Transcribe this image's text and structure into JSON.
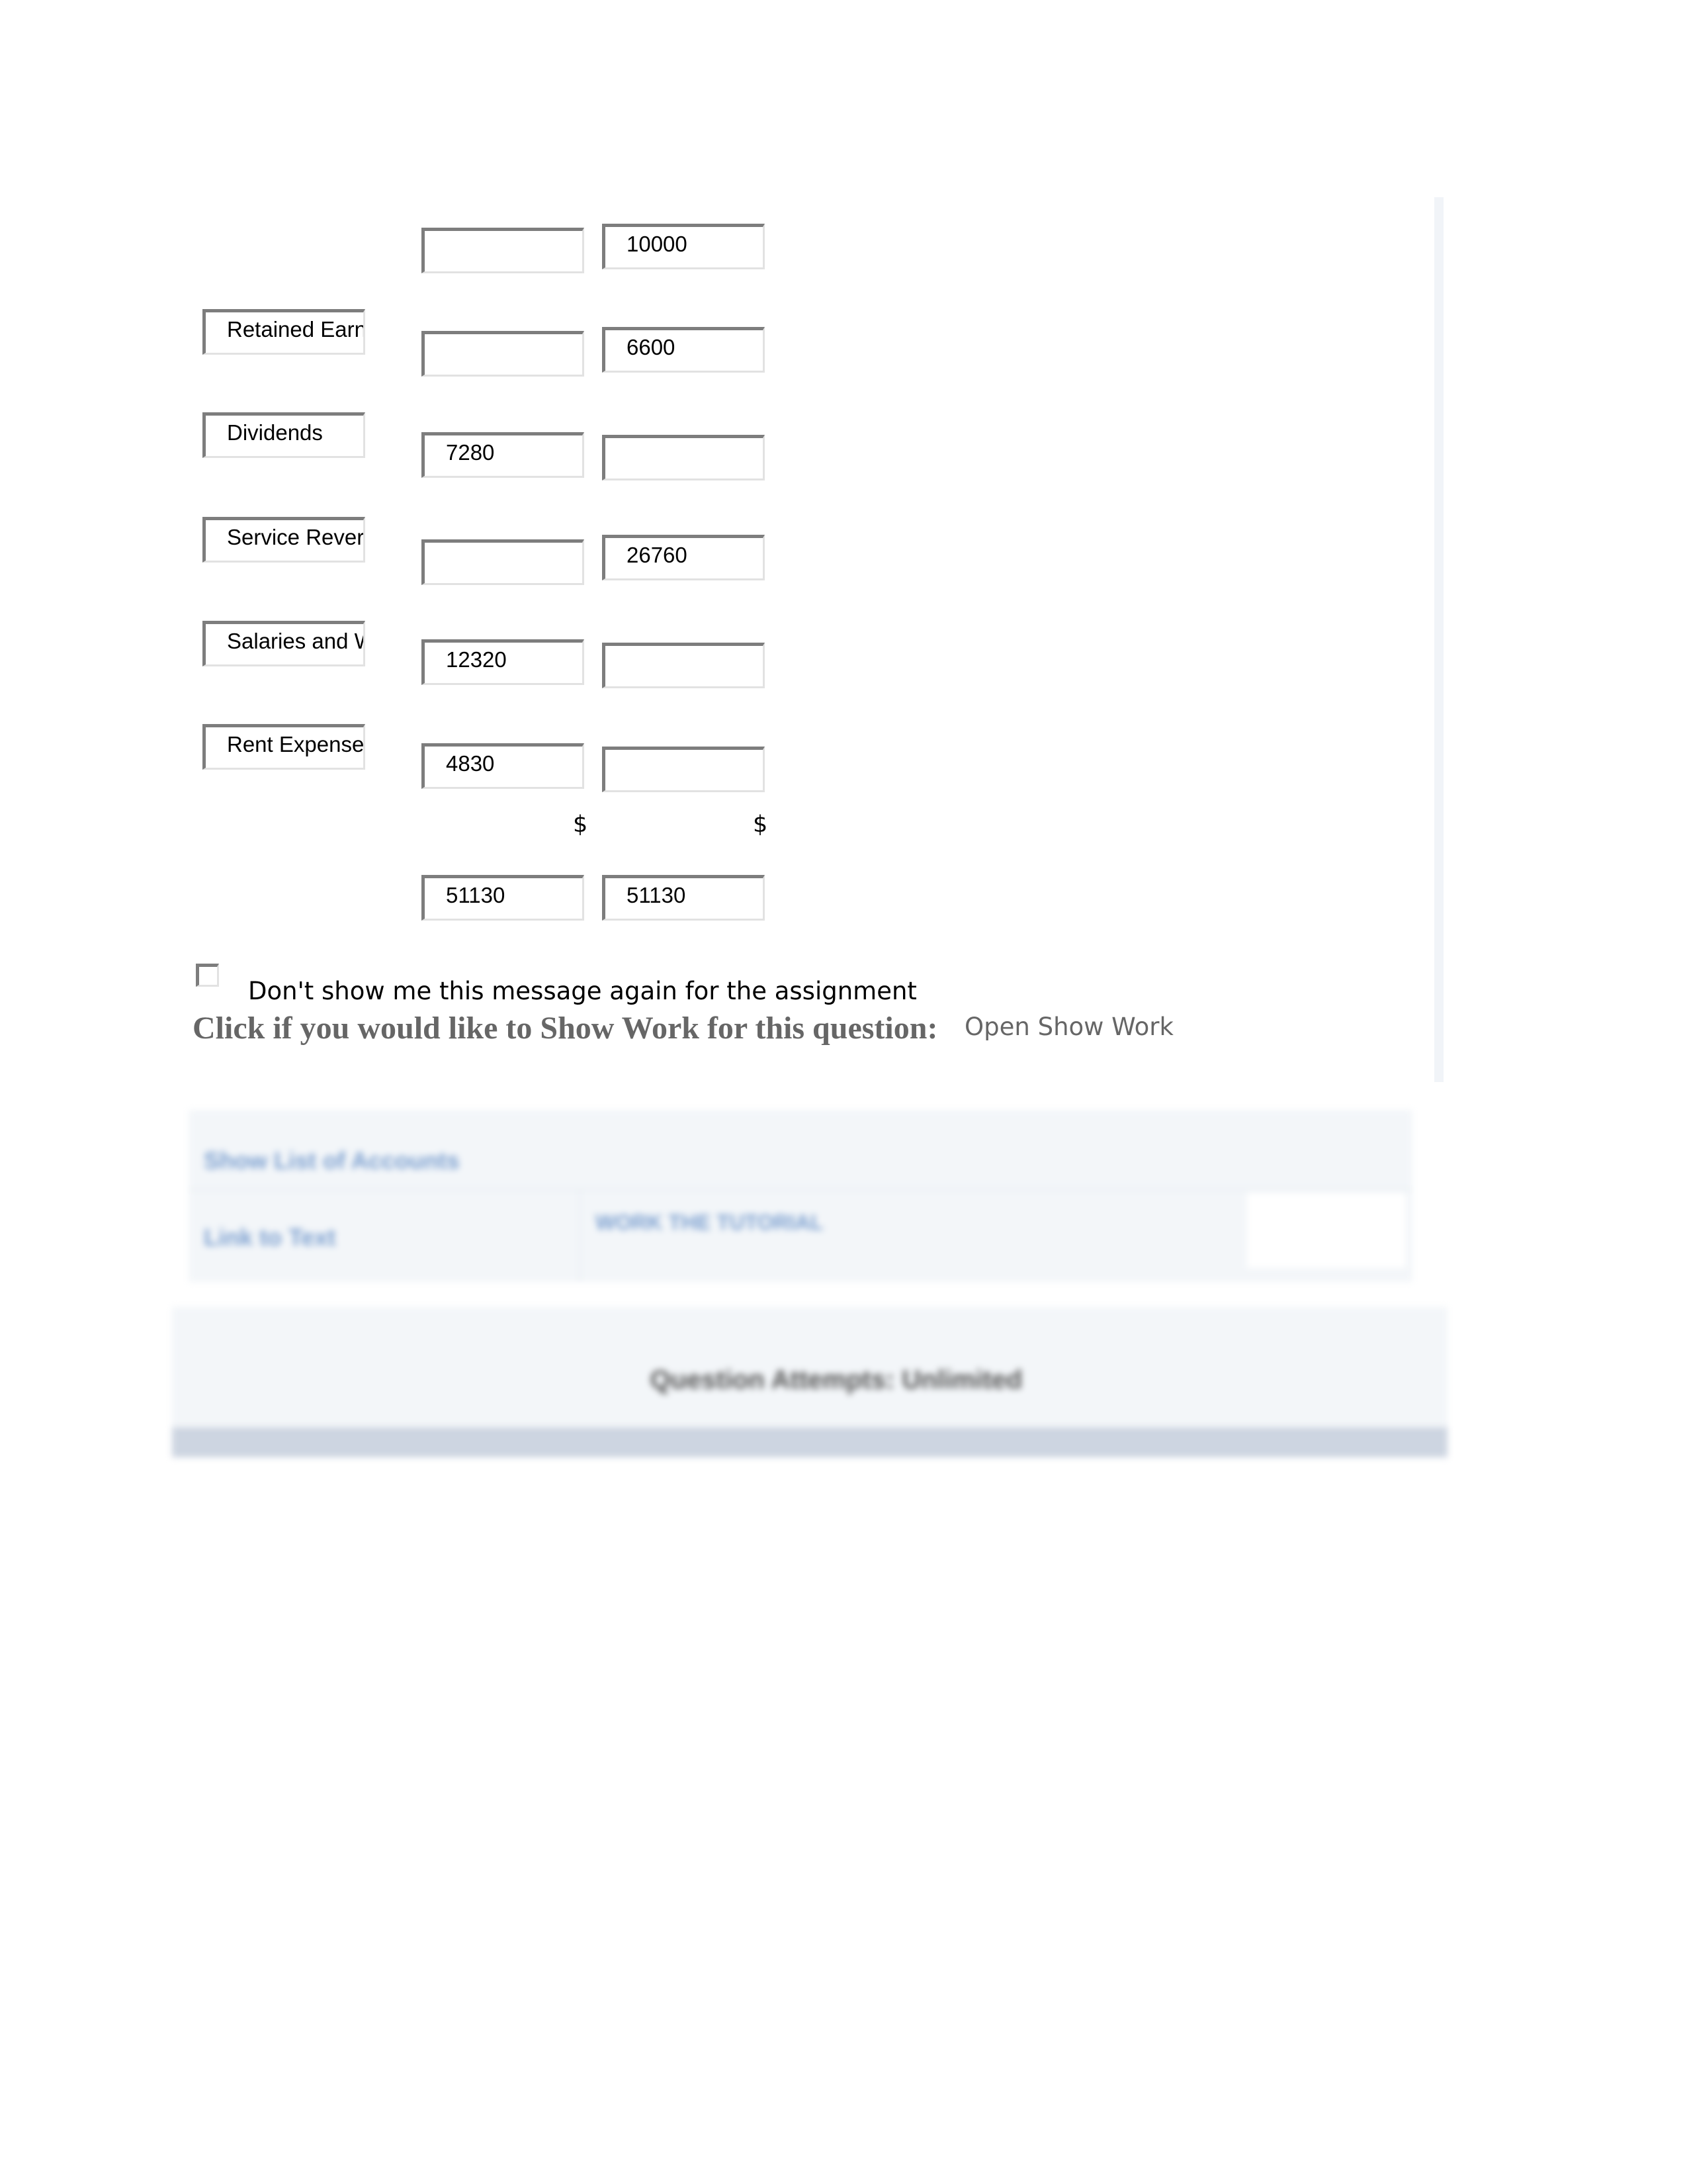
{
  "rows": [
    {
      "account": "",
      "debit": "",
      "credit": "10000"
    },
    {
      "account": "Retained Earn",
      "debit": "",
      "credit": "6600"
    },
    {
      "account": "Dividends",
      "debit": "7280",
      "credit": ""
    },
    {
      "account": "Service Rever",
      "debit": "",
      "credit": "26760"
    },
    {
      "account": "Salaries and W",
      "debit": "12320",
      "credit": ""
    },
    {
      "account": "Rent Expense",
      "debit": "4830",
      "credit": ""
    }
  ],
  "currency_symbol": "$",
  "totals": {
    "debit": "51130",
    "credit": "51130"
  },
  "dont_show_label": "Don't show me this message again for the assignment",
  "dont_show_checked": false,
  "show_work_prompt": "Click if you would like to Show Work for this question:",
  "open_show_work": "Open Show Work",
  "links": {
    "show_list": "Show List of Accounts",
    "link_to_text": "Link to Text",
    "tutorial": "WORK THE TUTORIAL"
  },
  "attempts": "Question Attempts: Unlimited"
}
